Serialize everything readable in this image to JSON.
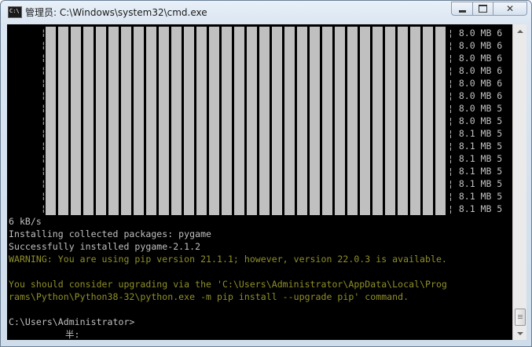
{
  "window": {
    "title": "管理员: C:\\Windows\\system32\\cmd.exe",
    "icon": "cmd-icon",
    "icon_text": "C:\\"
  },
  "controls": {
    "minimize": "minimize-icon",
    "maximize": "maximize-icon",
    "close_glyph": "✕"
  },
  "progress_rows": [
    "¦ 8.0 MB 6",
    "¦ 8.0 MB 6",
    "¦ 8.0 MB 6",
    "¦ 8.0 MB 6",
    "¦ 8.0 MB 6",
    "¦ 8.0 MB 6",
    "¦ 8.0 MB 5",
    "¦ 8.0 MB 5",
    "¦ 8.1 MB 5",
    "¦ 8.1 MB 5",
    "¦ 8.1 MB 5",
    "¦ 8.1 MB 5",
    "¦ 8.1 MB 5",
    "¦ 8.1 MB 5",
    "¦ 8.1 MB 5"
  ],
  "progress_left_char": "¦",
  "lines": [
    {
      "text": "6 kB/s",
      "color": "gray"
    },
    {
      "text": "Installing collected packages: pygame",
      "color": "gray"
    },
    {
      "text": "Successfully installed pygame-2.1.2",
      "color": "gray"
    },
    {
      "text": "WARNING: You are using pip version 21.1.1; however, version 22.0.3 is available.",
      "color": "olive"
    },
    {
      "text": "",
      "color": "gray"
    },
    {
      "text": "You should consider upgrading via the 'C:\\Users\\Administrator\\AppData\\Local\\Prog",
      "color": "olive"
    },
    {
      "text": "rams\\Python\\Python38-32\\python.exe -m pip install --upgrade pip' command.",
      "color": "olive"
    },
    {
      "text": "",
      "color": "gray"
    },
    {
      "text": "C:\\Users\\Administrator>",
      "color": "gray"
    }
  ],
  "ime_status": "半:",
  "colors": {
    "console_bg": "#000000",
    "text": "#c0c0c0",
    "warning": "#8f8f2a"
  }
}
